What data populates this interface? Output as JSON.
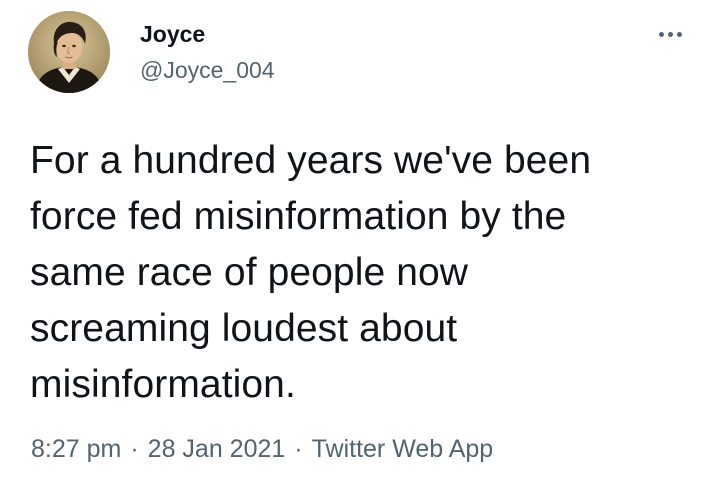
{
  "tweet": {
    "author": {
      "display_name": "Joyce",
      "handle": "@Joyce_004",
      "avatar_icon": "portrait-avatar"
    },
    "more_icon": "more-horizontal-icon",
    "text": "For a hundred years we've been\nforce fed misinformation by the\nsame race of people now\nscreaming loudest about\nmisinformation.",
    "time": "8:27 pm",
    "separator": "·",
    "date": "28 Jan 2021",
    "source": "Twitter Web App"
  },
  "colors": {
    "text_primary": "#0f1419",
    "text_secondary": "#536471",
    "background": "#ffffff"
  }
}
